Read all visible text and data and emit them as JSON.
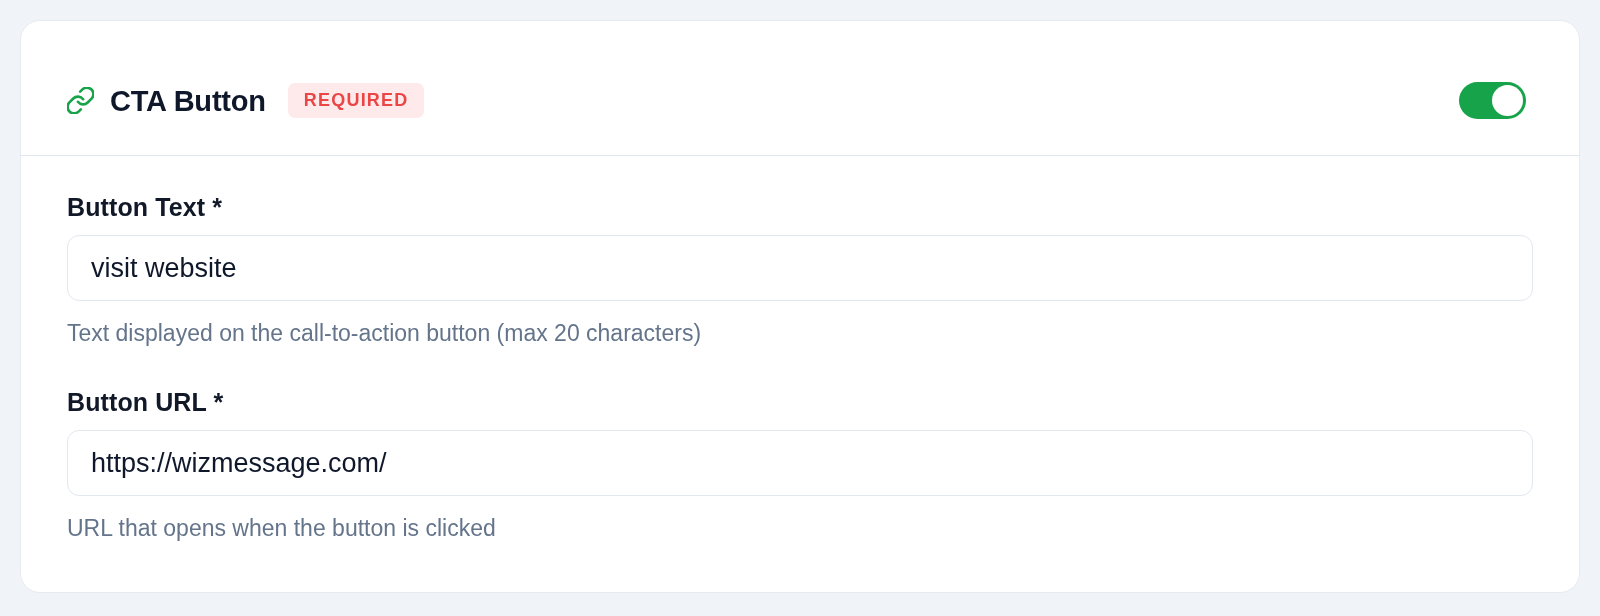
{
  "card": {
    "header": {
      "title": "CTA Button",
      "badge": "REQUIRED",
      "enabled": true
    },
    "fields": [
      {
        "label": "Button Text *",
        "value": "visit website",
        "help": "Text displayed on the call-to-action button (max 20 characters)"
      },
      {
        "label": "Button URL *",
        "value": "https://wizmessage.com/",
        "help": "URL that opens when the button is clicked"
      }
    ]
  }
}
